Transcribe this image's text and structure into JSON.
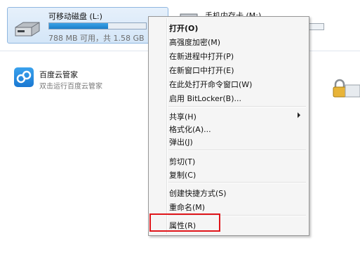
{
  "drives": {
    "primary": {
      "name": "可移动磁盘 (L:)",
      "space_text": "788 MB 可用，共 1.58 GB",
      "used_fraction": 0.5
    },
    "secondary": {
      "name": "手机内存卡 (M:)"
    }
  },
  "app": {
    "name": "百度云管家",
    "description": "双击运行百度云管家"
  },
  "context_menu": {
    "items": [
      {
        "label": "打开(O)",
        "bold": true
      },
      {
        "label": "高强度加密(M)"
      },
      {
        "label": "在新进程中打开(P)"
      },
      {
        "label": "在新窗口中打开(E)"
      },
      {
        "label": "在此处打开命令窗口(W)"
      },
      {
        "label": "启用 BitLocker(B)..."
      },
      {
        "label": "共享(H)",
        "submenu": true
      },
      {
        "label": "格式化(A)..."
      },
      {
        "label": "弹出(J)"
      },
      {
        "label": "剪切(T)"
      },
      {
        "label": "复制(C)"
      },
      {
        "label": "创建快捷方式(S)"
      },
      {
        "label": "重命名(M)"
      },
      {
        "label": "属性(R)"
      }
    ]
  },
  "colors": {
    "highlight_box": "#e0161b",
    "selection": "#cfe3f8",
    "menu_bg": "#f5f5f5"
  }
}
